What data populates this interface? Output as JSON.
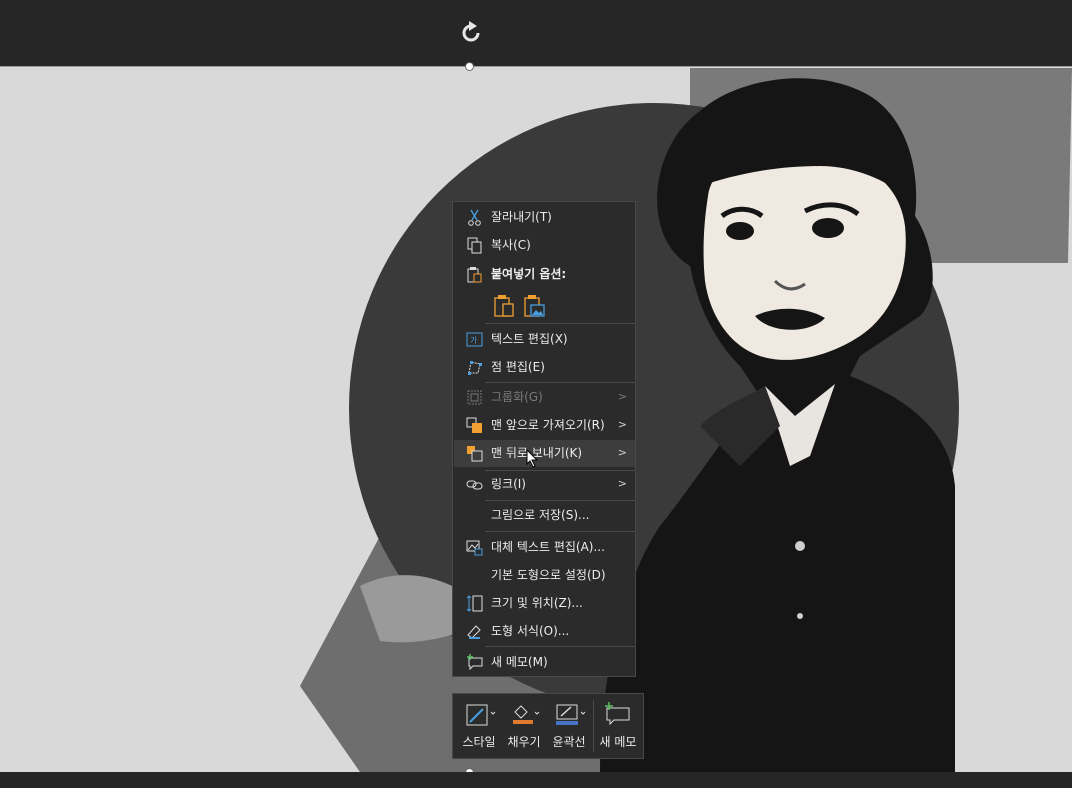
{
  "context_menu": {
    "items": [
      {
        "label": "잘라내기(T)",
        "icon": "scissors-icon",
        "enabled": true
      },
      {
        "label": "복사(C)",
        "icon": "copy-icon",
        "enabled": true
      },
      {
        "label": "붙여넣기 옵션:",
        "icon": "paste-icon",
        "enabled": true
      },
      {
        "label": "텍스트 편집(X)",
        "icon": "edit-text-icon",
        "enabled": true
      },
      {
        "label": "점 편집(E)",
        "icon": "edit-points-icon",
        "enabled": true
      },
      {
        "label": "그룹화(G)",
        "icon": "group-icon",
        "enabled": false,
        "submenu": true
      },
      {
        "label": "맨 앞으로 가져오기(R)",
        "icon": "bring-to-front-icon",
        "enabled": true,
        "submenu": true
      },
      {
        "label": "맨 뒤로 보내기(K)",
        "icon": "send-to-back-icon",
        "enabled": true,
        "submenu": true,
        "hovered": true
      },
      {
        "label": "링크(I)",
        "icon": "link-icon",
        "enabled": true,
        "submenu": true
      },
      {
        "label": "그림으로 저장(S)...",
        "icon": "",
        "enabled": true
      },
      {
        "label": "대체 텍스트 편집(A)...",
        "icon": "alt-text-icon",
        "enabled": true
      },
      {
        "label": "기본 도형으로 설정(D)",
        "icon": "",
        "enabled": true
      },
      {
        "label": "크기 및 위치(Z)...",
        "icon": "size-position-icon",
        "enabled": true
      },
      {
        "label": "도형 서식(O)...",
        "icon": "format-shape-icon",
        "enabled": true
      },
      {
        "label": "새 메모(M)",
        "icon": "new-comment-icon",
        "enabled": true
      }
    ],
    "paste_options": [
      "paste-keep-format-icon",
      "paste-picture-icon"
    ]
  },
  "mini_toolbar": {
    "buttons": [
      {
        "label": "스타일",
        "icon": "shape-style-icon"
      },
      {
        "label": "채우기",
        "icon": "fill-bucket-icon",
        "color": "#e07a2e"
      },
      {
        "label": "윤곽선",
        "icon": "outline-pen-icon",
        "color": "#4472c4"
      },
      {
        "label": "새 메모",
        "icon": "new-comment-icon"
      }
    ]
  },
  "colors": {
    "app_background": "#262626",
    "slide_background": "#d9d9d9",
    "menu_background": "#2b2b2b",
    "paste_icon_accent": "#f0a030",
    "edit_icon_accent": "#4a9fe0",
    "fill_accent": "#e07a2e",
    "outline_accent": "#4472c4",
    "comment_accent": "#5cc060"
  }
}
